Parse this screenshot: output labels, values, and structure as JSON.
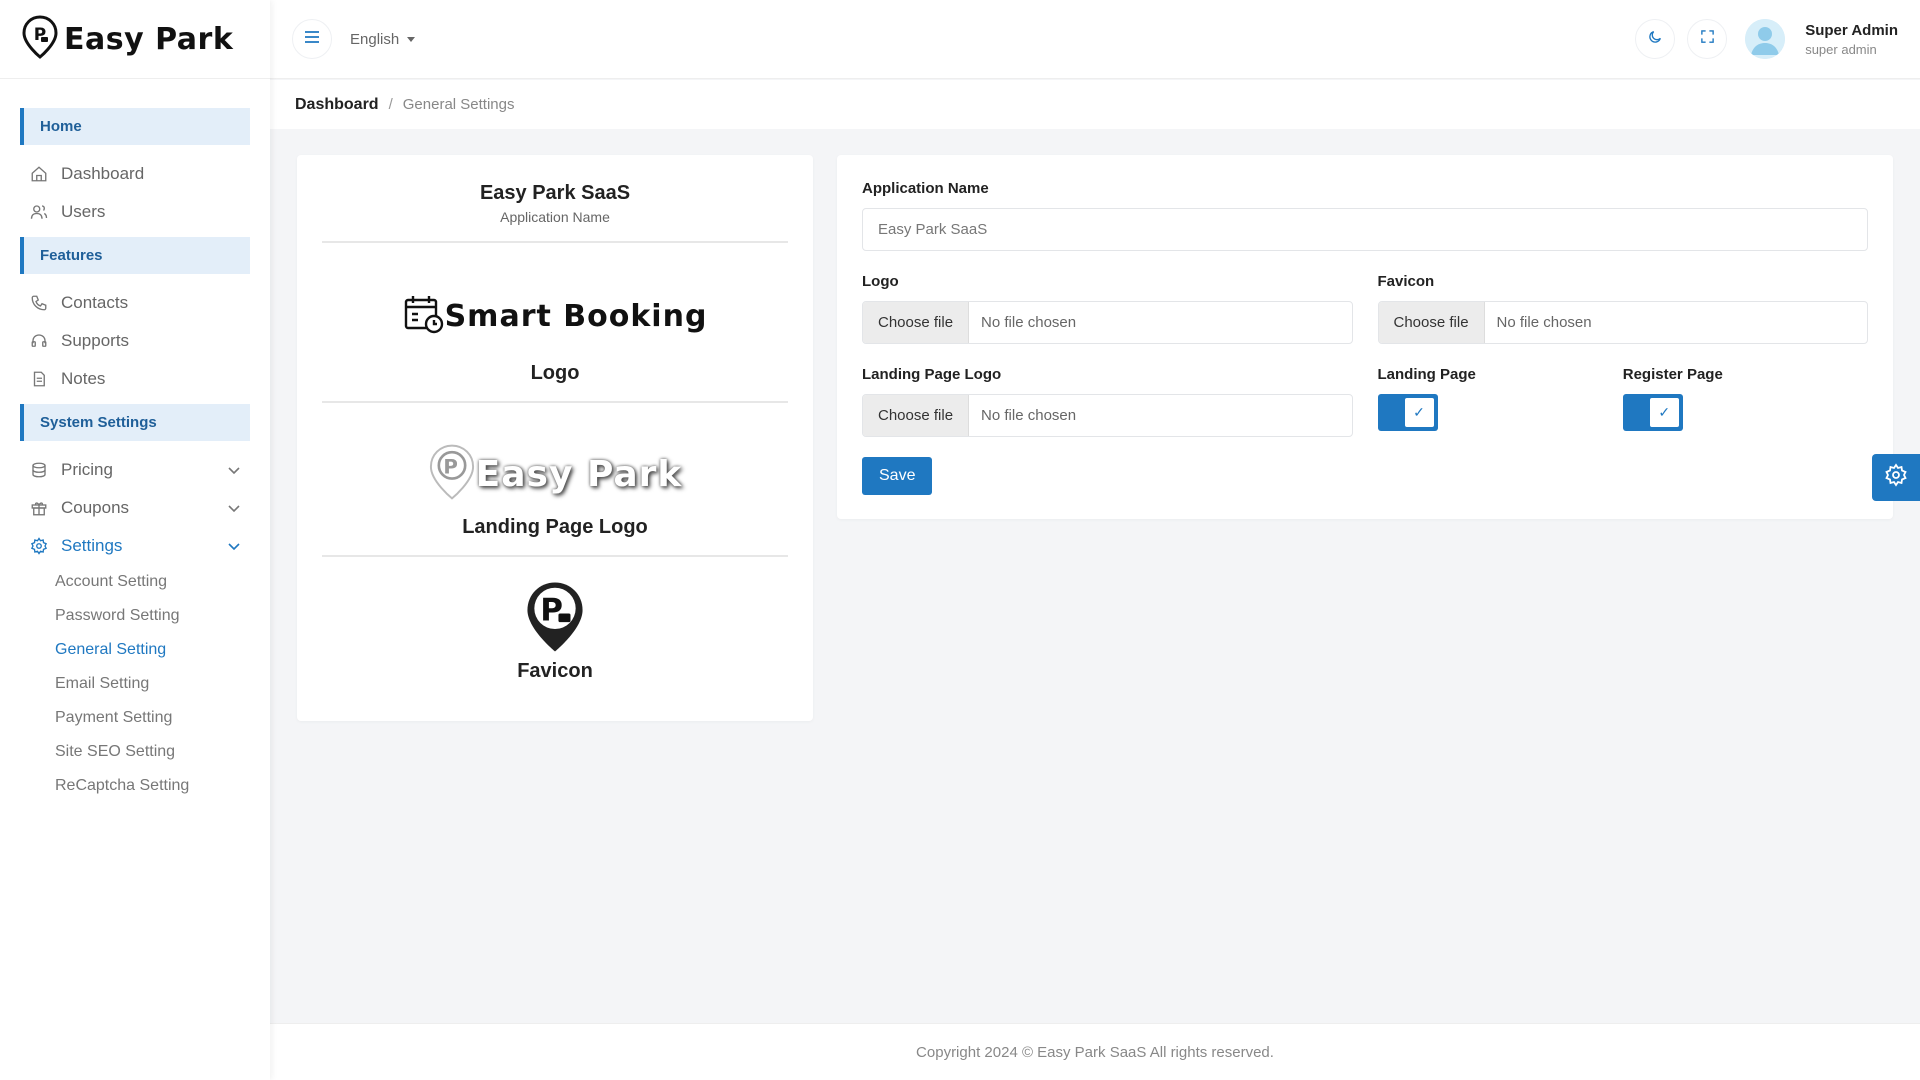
{
  "brand": {
    "name": "Easy Park"
  },
  "sidebar": {
    "sections": [
      {
        "title": "Home",
        "items": [
          {
            "label": "Dashboard",
            "icon": "home-icon"
          },
          {
            "label": "Users",
            "icon": "users-icon"
          }
        ]
      },
      {
        "title": "Features",
        "items": [
          {
            "label": "Contacts",
            "icon": "phone-icon"
          },
          {
            "label": "Supports",
            "icon": "headset-icon"
          },
          {
            "label": "Notes",
            "icon": "note-icon"
          }
        ]
      },
      {
        "title": "System Settings",
        "items": [
          {
            "label": "Pricing",
            "icon": "database-icon"
          },
          {
            "label": "Coupons",
            "icon": "gift-icon"
          },
          {
            "label": "Settings",
            "icon": "gear-icon"
          }
        ]
      }
    ],
    "settings_sub": [
      "Account Setting",
      "Password Setting",
      "General Setting",
      "Email Setting",
      "Payment Setting",
      "Site SEO Setting",
      "ReCaptcha Setting"
    ],
    "active_sub": "General Setting"
  },
  "topbar": {
    "language": "English",
    "user_name": "Super Admin",
    "user_role": "super admin"
  },
  "breadcrumb": {
    "root": "Dashboard",
    "current": "General Settings"
  },
  "preview": {
    "app_name": "Easy Park SaaS",
    "app_name_caption": "Application Name",
    "logo_text": "Smart Booking",
    "logo_caption": "Logo",
    "landing_logo_text": "Easy Park",
    "landing_logo_caption": "Landing Page Logo",
    "favicon_caption": "Favicon"
  },
  "form": {
    "app_name_label": "Application Name",
    "app_name_value": "Easy Park SaaS",
    "logo_label": "Logo",
    "favicon_label": "Favicon",
    "landing_logo_label": "Landing Page Logo",
    "landing_page_label": "Landing Page",
    "register_page_label": "Register Page",
    "choose_file": "Choose file",
    "no_file": "No file chosen",
    "landing_page_enabled": true,
    "register_page_enabled": true,
    "save_label": "Save"
  },
  "footer": {
    "text": "Copyright 2024 © Easy Park SaaS All rights reserved."
  },
  "colors": {
    "accent": "#1f78c1",
    "background": "#f4f5f7"
  }
}
